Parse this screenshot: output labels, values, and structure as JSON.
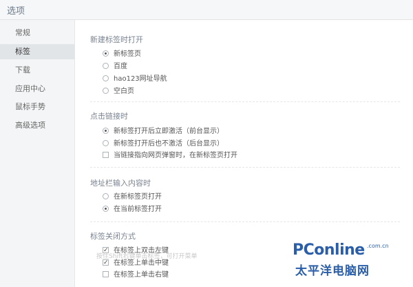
{
  "window": {
    "title": "选项"
  },
  "sidebar": {
    "items": [
      {
        "label": "常规"
      },
      {
        "label": "标签"
      },
      {
        "label": "下载"
      },
      {
        "label": "应用中心"
      },
      {
        "label": "鼠标手势"
      },
      {
        "label": "高级选项"
      }
    ],
    "active_index": 1
  },
  "sections": {
    "new_tab": {
      "title": "新建标签时打开",
      "options": [
        {
          "label": "新标签页",
          "checked": true
        },
        {
          "label": "百度",
          "checked": false
        },
        {
          "label": "hao123网址导航",
          "checked": false
        },
        {
          "label": "空白页",
          "checked": false
        }
      ]
    },
    "click_link": {
      "title": "点击链接时",
      "options": [
        {
          "label": "新标签打开后立即激活（前台显示）",
          "checked": true
        },
        {
          "label": "新标签打开后也不激活（后台显示）",
          "checked": false
        },
        {
          "label": "当链接指向网页弹窗时，在新标签页打开",
          "checked": false
        }
      ]
    },
    "address_input": {
      "title": "地址栏输入内容时",
      "options": [
        {
          "label": "在新标签页打开",
          "checked": false
        },
        {
          "label": "在当前标签打开",
          "checked": true
        }
      ]
    },
    "tab_close": {
      "title": "标签关闭方式",
      "options": [
        {
          "label": "在标签上双击左键",
          "checked": true
        },
        {
          "label": "在标签上单击中键",
          "checked": true
        },
        {
          "label": "在标签上单击右键",
          "checked": false
        }
      ]
    }
  },
  "hint": "按住Shift右键单击标签，可打开菜单",
  "watermark": {
    "logo": "PConline",
    "domain": ".com.cn",
    "cn": "太平洋电脑网"
  },
  "colors": {
    "accent": "#2b5ea8",
    "watermark_orange": "#f39b1b"
  }
}
